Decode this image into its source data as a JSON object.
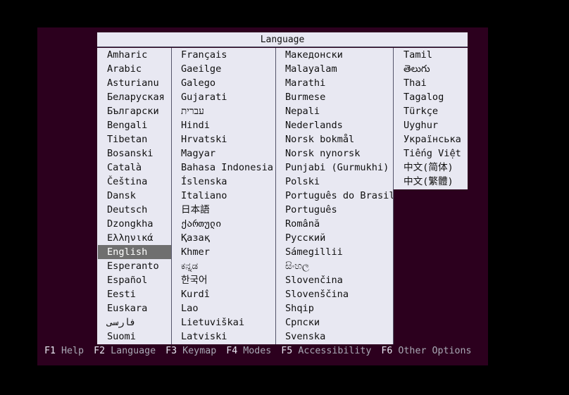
{
  "dialog": {
    "title": "Language",
    "columns": [
      [
        "Amharic",
        "Arabic",
        "Asturianu",
        "Беларуская",
        "Български",
        "Bengali",
        "Tibetan",
        "Bosanski",
        "Català",
        "Čeština",
        "Dansk",
        "Deutsch",
        "Dzongkha",
        "Ελληνικά",
        "English",
        "Esperanto",
        "Español",
        "Eesti",
        "Euskara",
        "فارسی",
        "Suomi"
      ],
      [
        "Français",
        "Gaeilge",
        "Galego",
        "Gujarati",
        "עברית",
        "Hindi",
        "Hrvatski",
        "Magyar",
        "Bahasa Indonesia",
        "Íslenska",
        "Italiano",
        "日本語",
        "ქართული",
        "Қазақ",
        "Khmer",
        "ಕನ್ನಡ",
        "한국어",
        "Kurdî",
        "Lao",
        "Lietuviškai",
        "Latviski"
      ],
      [
        "Македонски",
        "Malayalam",
        "Marathi",
        "Burmese",
        "Nepali",
        "Nederlands",
        "Norsk bokmål",
        "Norsk nynorsk",
        "Punjabi (Gurmukhi)",
        "Polski",
        "Português do Brasil",
        "Português",
        "Română",
        "Русский",
        "Sámegillii",
        "සිංහල",
        "Slovenčina",
        "Slovenščina",
        "Shqip",
        "Српски",
        "Svenska"
      ],
      [
        "Tamil",
        "తెలుగు",
        "Thai",
        "Tagalog",
        "Türkçe",
        "Uyghur",
        "Українська",
        "Tiếng Việt",
        "中文(简体)",
        "中文(繁體)"
      ]
    ],
    "selected": "English"
  },
  "function_keys": [
    {
      "key": "F1",
      "label": "Help"
    },
    {
      "key": "F2",
      "label": "Language"
    },
    {
      "key": "F3",
      "label": "Keymap"
    },
    {
      "key": "F4",
      "label": "Modes"
    },
    {
      "key": "F5",
      "label": "Accessibility"
    },
    {
      "key": "F6",
      "label": "Other Options"
    }
  ],
  "colors": {
    "screen_bg": "#2c001e",
    "dialog_bg": "#e8e8f2",
    "selection_bg": "#6f6f6f"
  }
}
